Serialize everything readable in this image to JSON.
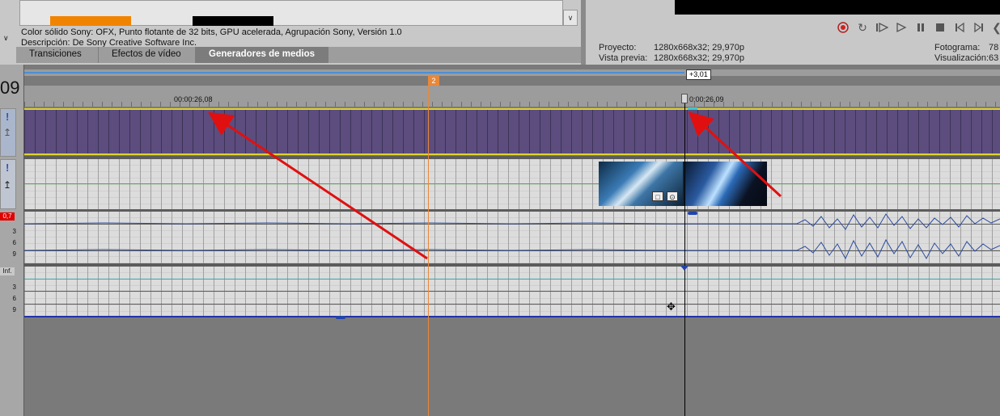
{
  "media_generator": {
    "description_line1": "Color sólido Sony: OFX, Punto flotante de 32 bits, GPU acelerada, Agrupación Sony, Versión 1.0",
    "description_line2": "Descripción: De Sony Creative Software Inc.",
    "swatch_colors": [
      "#f08400",
      "#000000"
    ]
  },
  "tabs": [
    {
      "label": "Transiciones",
      "active": false
    },
    {
      "label": "Efectos de vídeo",
      "active": false
    },
    {
      "label": "Generadores de medios",
      "active": true
    }
  ],
  "preview": {
    "project_label": "Proyecto:",
    "project_value": "1280x668x32; 29,970p",
    "preview_label": "Vista previa:",
    "preview_value": "1280x668x32; 29,970p",
    "frame_label": "Fotograma:",
    "frame_value": "78",
    "display_label": "Visualización:",
    "display_value": "63"
  },
  "transport": {
    "buttons": [
      "record-icon",
      "loop-icon",
      "play-from-start-icon",
      "play-icon",
      "pause-icon",
      "stop-icon",
      "prev-frame-icon",
      "next-frame-icon",
      "rewind-icon"
    ],
    "record_color": "#d12020"
  },
  "timeline": {
    "current_time_partial": "09",
    "marker_label": "2",
    "delta_label": "+3,01",
    "ruler_labels": [
      "00:00:26,08",
      "0:00:26,09"
    ]
  },
  "tracks": {
    "audio1_level": "0,7",
    "audio2_level": "Inf.",
    "meter_ticks": [
      "3",
      "6",
      "9"
    ]
  }
}
